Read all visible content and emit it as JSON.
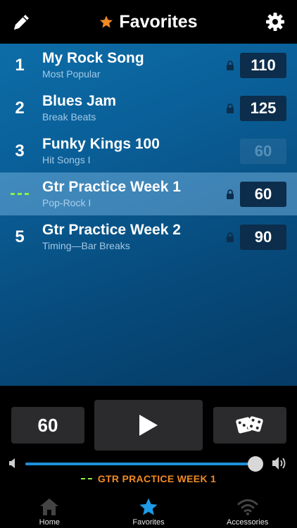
{
  "header": {
    "title": "Favorites",
    "icons": {
      "left": "pencil-icon",
      "right": "gear-icon",
      "title": "star-icon"
    },
    "accent": "#f08a24"
  },
  "songs": [
    {
      "number": "1",
      "name": "My Rock Song",
      "subtitle": "Most Popular",
      "tempo": "110",
      "locked": true,
      "selected": false,
      "faded": false
    },
    {
      "number": "2",
      "name": "Blues Jam",
      "subtitle": "Break Beats",
      "tempo": "125",
      "locked": true,
      "selected": false,
      "faded": false
    },
    {
      "number": "3",
      "name": "Funky Kings 100",
      "subtitle": "Hit Songs I",
      "tempo": "60",
      "locked": false,
      "selected": false,
      "faded": true
    },
    {
      "number": "",
      "name": "Gtr Practice Week 1",
      "subtitle": "Pop-Rock I",
      "tempo": "60",
      "locked": true,
      "selected": true,
      "faded": false
    },
    {
      "number": "5",
      "name": "Gtr Practice Week 2",
      "subtitle": "Timing—Bar Breaks",
      "tempo": "90",
      "locked": true,
      "selected": false,
      "faded": false
    }
  ],
  "player": {
    "tempo": "60",
    "play_icon": "play-icon",
    "dice_icon": "dice-icon",
    "volume_level": 0.99,
    "now_playing": "GTR PRACTICE WEEK 1"
  },
  "tabs": [
    {
      "label": "Home",
      "icon": "home-icon",
      "active": false
    },
    {
      "label": "Favorites",
      "icon": "star-icon",
      "active": true
    },
    {
      "label": "Accessories",
      "icon": "wifi-icon",
      "active": false
    }
  ],
  "colors": {
    "selected_marker": "#8bf24a",
    "star_active": "#1e9be8",
    "slider_fill": "#1e8fd8"
  }
}
